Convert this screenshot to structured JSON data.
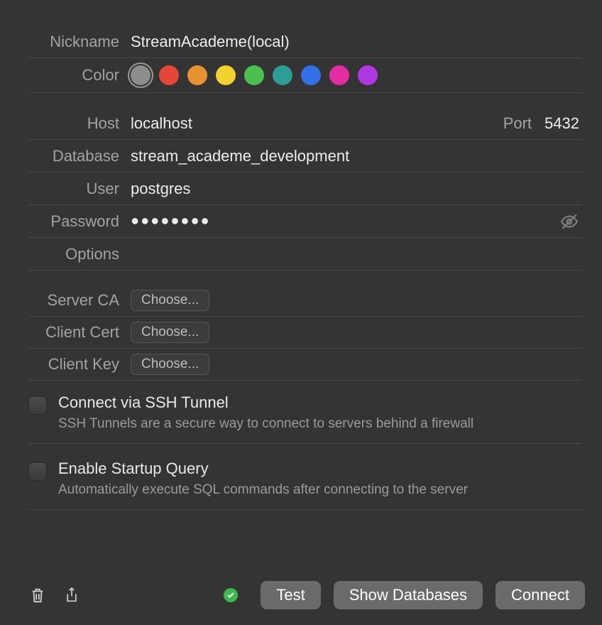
{
  "labels": {
    "nickname": "Nickname",
    "color": "Color",
    "host": "Host",
    "port": "Port",
    "database": "Database",
    "user": "User",
    "password": "Password",
    "options": "Options",
    "server_ca": "Server CA",
    "client_cert": "Client Cert",
    "client_key": "Client Key"
  },
  "values": {
    "nickname": "StreamAcademe(local)",
    "host": "localhost",
    "port": "5432",
    "database": "stream_academe_development",
    "user": "postgres",
    "password_mask": "●●●●●●●●",
    "options": ""
  },
  "colors": [
    "#8d8d8d",
    "#e64637",
    "#e5922f",
    "#f1d22e",
    "#4cc04f",
    "#2d9e93",
    "#3370e6",
    "#e42da0",
    "#b038e4"
  ],
  "choose_label": "Choose...",
  "ssh": {
    "title": "Connect via SSH Tunnel",
    "desc": "SSH Tunnels are a secure way to connect to servers behind a firewall"
  },
  "startup": {
    "title": "Enable Startup Query",
    "desc": "Automatically execute SQL commands after connecting to the server"
  },
  "buttons": {
    "test": "Test",
    "show_db": "Show Databases",
    "connect": "Connect"
  }
}
